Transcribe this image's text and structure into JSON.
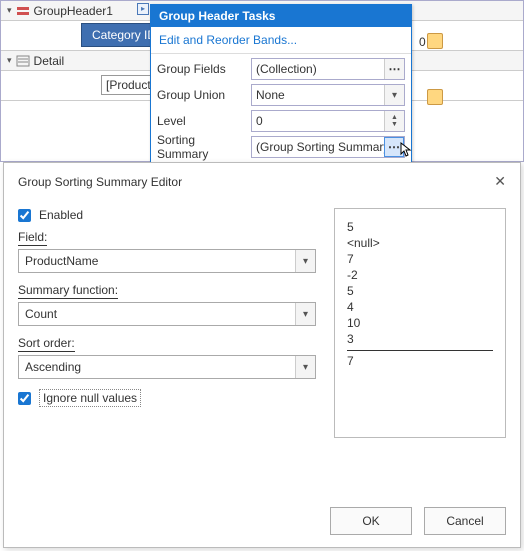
{
  "designer": {
    "group_header_band": "GroupHeader1",
    "category_label": "Category ID",
    "detail_band": "Detail",
    "product_label": "[Product",
    "side_value": "0"
  },
  "tasks": {
    "title": "Group Header Tasks",
    "link": "Edit and Reorder Bands...",
    "rows": {
      "group_fields_label": "Group Fields",
      "group_fields_value": "(Collection)",
      "group_union_label": "Group Union",
      "group_union_value": "None",
      "level_label": "Level",
      "level_value": "0",
      "sorting_summary_label": "Sorting Summary",
      "sorting_summary_value": "(Group Sorting Summary)"
    }
  },
  "editor": {
    "title": "Group Sorting Summary Editor",
    "enabled_label": "Enabled",
    "enabled_checked": true,
    "field_label": "Field:",
    "field_value": "ProductName",
    "summary_fn_label": "Summary function:",
    "summary_fn_value": "Count",
    "sort_order_label": "Sort order:",
    "sort_order_value": "Ascending",
    "ignore_nulls_label": "Ignore null values",
    "ignore_nulls_checked": true,
    "preview_values": [
      "5",
      "<null>",
      "7",
      "-2",
      "5",
      "4",
      "10",
      "3"
    ],
    "preview_result": "7",
    "ok": "OK",
    "cancel": "Cancel"
  }
}
